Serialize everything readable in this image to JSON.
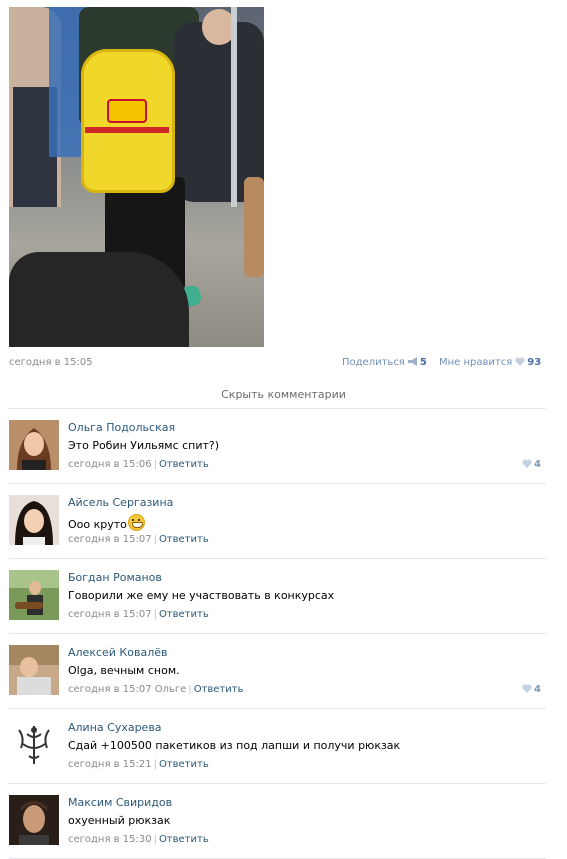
{
  "post": {
    "timestamp": "сегодня в 15:05",
    "share_label": "Поделиться",
    "share_count": "5",
    "like_label": "Мне нравится",
    "like_count": "93"
  },
  "hide_comments_label": "Скрыть комментарии",
  "comments": [
    {
      "author": "Ольга Подольская",
      "text": "Это Робин Уильямс спит?)",
      "time": "сегодня в 15:06",
      "reply_to": "",
      "reply_label": "Ответить",
      "likes": "4",
      "avatar_color": "#8a5a3c"
    },
    {
      "author": "Айсель Сергазина",
      "text": "Ооо круто",
      "time": "сегодня в 15:07",
      "reply_to": "",
      "reply_label": "Ответить",
      "likes": "",
      "avatar_color": "#3a2a22"
    },
    {
      "author": "Богдан Романов",
      "text": "Говорили же ему не участвовать в конкурсах",
      "time": "сегодня в 15:07",
      "reply_to": "",
      "reply_label": "Ответить",
      "likes": "",
      "avatar_color": "#4f6e3a"
    },
    {
      "author": "Алексей Ковалёв",
      "text": "Olga, вечным сном.",
      "time": "сегодня в 15:07",
      "reply_to": "Ольге",
      "reply_label": "Ответить",
      "likes": "4",
      "avatar_color": "#9a7a5a"
    },
    {
      "author": "Алина Сухарева",
      "text": "Сдай +100500 пакетиков из под лапши и получи рюкзак",
      "time": "сегодня в 15:21",
      "reply_to": "",
      "reply_label": "Ответить",
      "likes": "",
      "avatar_color": "#ffffff"
    },
    {
      "author": "Максим Свиридов",
      "text": "охуенный рюкзак",
      "time": "сегодня в 15:30",
      "reply_to": "",
      "reply_label": "Ответить",
      "likes": "",
      "avatar_color": "#3b2a20"
    }
  ],
  "colors": {
    "link": "#2b587a",
    "meta": "#8a8a8a",
    "like": "#7e97b3",
    "separator": "#e4e6e9"
  }
}
